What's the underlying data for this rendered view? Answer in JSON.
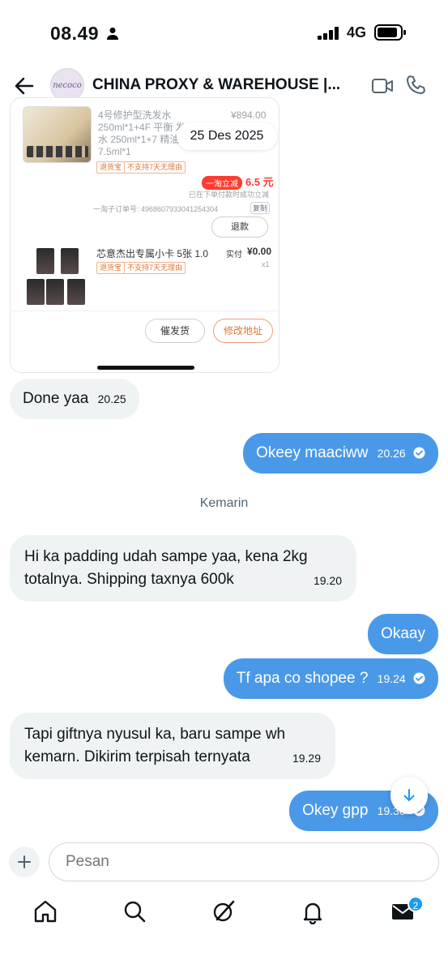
{
  "status_bar": {
    "time": "08.49",
    "network": "4G"
  },
  "header": {
    "title": "CHINA PROXY & WAREHOUSE |...",
    "avatar_text": "necoco"
  },
  "order_card": {
    "product1_name": "4号修护型洗发水 250ml*1+4F 平衡 发水 250ml*1+7 精油 7.5ml*1",
    "product1_price": "¥894.00",
    "date_pill": "25 Des 2025",
    "tag_return": "退货宝",
    "tag_no7day": "不支持7天无理由",
    "discount_label": "一淘立减",
    "discount_value": "6.5 元",
    "discount_note": "已在下单付款时成功立减",
    "sub_order": "一淘子订单号: 4968607933041254304",
    "copy_label": "复制",
    "refund_label": "退款",
    "product2_name": "芯意杰出专属小卡 5张 1.0",
    "paid_label": "实付",
    "paid_value": "¥0.00",
    "qty": "x1",
    "urge_button": "催发货",
    "edit_address_button": "修改地址"
  },
  "messages": [
    {
      "dir": "in",
      "text": "Done yaa",
      "time": "20.25"
    },
    {
      "dir": "out",
      "text": "Okeey maaciww",
      "time": "20.26"
    },
    {
      "dir": "in",
      "text": "Hi ka padding udah sampe yaa, kena 2kg totalnya. Shipping taxnya 600k",
      "time": "19.20"
    },
    {
      "dir": "out",
      "text": "Okaay",
      "time": ""
    },
    {
      "dir": "out",
      "text": "Tf apa co shopee ?",
      "time": "19.24"
    },
    {
      "dir": "in",
      "text": "Tapi giftnya nyusul ka, baru sampe wh kemarn. Dikirim terpisah ternyata",
      "time": "19.29"
    },
    {
      "dir": "out",
      "text": "Okey gpp",
      "time": "19.30"
    }
  ],
  "divider": "Kemarin",
  "composer": {
    "placeholder": "Pesan"
  },
  "tabbar": {
    "messages_badge": "2"
  },
  "colors": {
    "outgoing": "#4a99e9",
    "incoming": "#eff3f4",
    "badge": "#1d9bf0"
  }
}
